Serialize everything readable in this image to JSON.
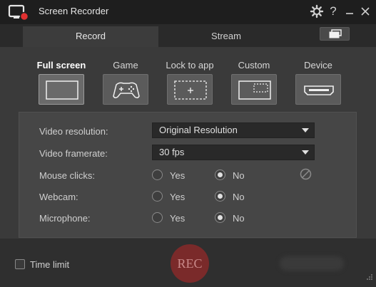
{
  "window": {
    "title": "Screen Recorder",
    "settings_icon": "gear-icon",
    "help_label": "?",
    "minimize_label": "—",
    "close_label": "✕"
  },
  "tabs": [
    {
      "label": "Record",
      "active": true
    },
    {
      "label": "Stream",
      "active": false
    }
  ],
  "modes": [
    {
      "label": "Full screen",
      "icon": "full-screen-icon",
      "active": true
    },
    {
      "label": "Game",
      "icon": "gamepad-icon",
      "active": false
    },
    {
      "label": "Lock to app",
      "icon": "lock-to-app-icon",
      "active": false
    },
    {
      "label": "Custom",
      "icon": "custom-region-icon",
      "active": false
    },
    {
      "label": "Device",
      "icon": "hdmi-device-icon",
      "active": false
    }
  ],
  "settings": {
    "video_resolution": {
      "label": "Video resolution:",
      "value": "Original Resolution"
    },
    "video_framerate": {
      "label": "Video framerate:",
      "value": "30 fps"
    },
    "mouse_clicks": {
      "label": "Mouse clicks:",
      "yes": "Yes",
      "no": "No",
      "selected": "No"
    },
    "webcam": {
      "label": "Webcam:",
      "yes": "Yes",
      "no": "No",
      "selected": "No"
    },
    "microphone": {
      "label": "Microphone:",
      "yes": "Yes",
      "no": "No",
      "selected": "No"
    }
  },
  "footer": {
    "time_limit_label": "Time limit",
    "time_limit_checked": false,
    "rec_label": "REC"
  },
  "colors": {
    "background": "#2b2b2b",
    "panel": "#464646",
    "rec_button": "#7a2a2a",
    "app_icon_accent": "#e03030"
  }
}
